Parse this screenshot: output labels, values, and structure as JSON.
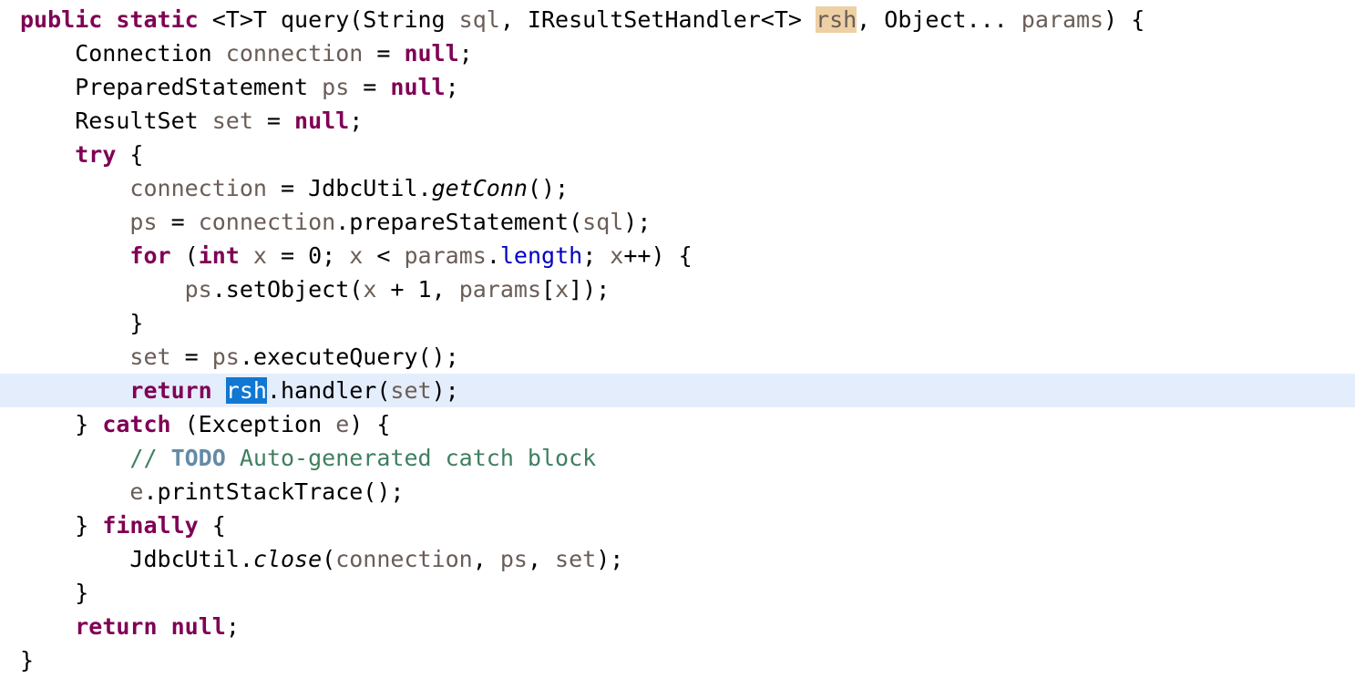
{
  "editor": {
    "language": "java",
    "colors": {
      "background": "#FFFFFF",
      "keyword": "#7F0055",
      "comment": "#3F7F5F",
      "todo": "#638BA6",
      "field": "#0000C0",
      "local_variable": "#6A5D57",
      "occurrence_highlight": "#EDD1A4",
      "selection_background": "#1077D3",
      "selection_foreground": "#FFFFFF",
      "current_line_background": "#E4EDFB",
      "plain_text": "#000000"
    },
    "selection": {
      "text": "rsh",
      "line_index": 10
    },
    "occurrence_highlight": {
      "text": "rsh",
      "line_index": 0
    },
    "current_line_index": 10,
    "lines": [
      {
        "index": 0,
        "current": false,
        "tokens": [
          {
            "t": "public",
            "c": "keyword"
          },
          {
            "t": " ",
            "c": "plain"
          },
          {
            "t": "static",
            "c": "keyword"
          },
          {
            "t": " <T>T query(String ",
            "c": "plain"
          },
          {
            "t": "sql",
            "c": "param"
          },
          {
            "t": ", IResultSetHandler<T> ",
            "c": "plain"
          },
          {
            "t": "rsh",
            "c": "param",
            "hl": "occurrence"
          },
          {
            "t": ", Object... ",
            "c": "plain"
          },
          {
            "t": "params",
            "c": "param"
          },
          {
            "t": ") {",
            "c": "plain"
          }
        ]
      },
      {
        "index": 1,
        "current": false,
        "tokens": [
          {
            "t": "    Connection ",
            "c": "plain"
          },
          {
            "t": "connection",
            "c": "local"
          },
          {
            "t": " = ",
            "c": "plain"
          },
          {
            "t": "null",
            "c": "keyword"
          },
          {
            "t": ";",
            "c": "plain"
          }
        ]
      },
      {
        "index": 2,
        "current": false,
        "tokens": [
          {
            "t": "    PreparedStatement ",
            "c": "plain"
          },
          {
            "t": "ps",
            "c": "local"
          },
          {
            "t": " = ",
            "c": "plain"
          },
          {
            "t": "null",
            "c": "keyword"
          },
          {
            "t": ";",
            "c": "plain"
          }
        ]
      },
      {
        "index": 3,
        "current": false,
        "tokens": [
          {
            "t": "    ResultSet ",
            "c": "plain"
          },
          {
            "t": "set",
            "c": "local"
          },
          {
            "t": " = ",
            "c": "plain"
          },
          {
            "t": "null",
            "c": "keyword"
          },
          {
            "t": ";",
            "c": "plain"
          }
        ]
      },
      {
        "index": 4,
        "current": false,
        "tokens": [
          {
            "t": "    ",
            "c": "plain"
          },
          {
            "t": "try",
            "c": "keyword"
          },
          {
            "t": " {",
            "c": "plain"
          }
        ]
      },
      {
        "index": 5,
        "current": false,
        "tokens": [
          {
            "t": "        ",
            "c": "plain"
          },
          {
            "t": "connection",
            "c": "local"
          },
          {
            "t": " = JdbcUtil.",
            "c": "plain"
          },
          {
            "t": "getConn",
            "c": "static"
          },
          {
            "t": "();",
            "c": "plain"
          }
        ]
      },
      {
        "index": 6,
        "current": false,
        "tokens": [
          {
            "t": "        ",
            "c": "plain"
          },
          {
            "t": "ps",
            "c": "local"
          },
          {
            "t": " = ",
            "c": "plain"
          },
          {
            "t": "connection",
            "c": "local"
          },
          {
            "t": ".prepareStatement(",
            "c": "plain"
          },
          {
            "t": "sql",
            "c": "param"
          },
          {
            "t": ");",
            "c": "plain"
          }
        ]
      },
      {
        "index": 7,
        "current": false,
        "tokens": [
          {
            "t": "        ",
            "c": "plain"
          },
          {
            "t": "for",
            "c": "keyword"
          },
          {
            "t": " (",
            "c": "plain"
          },
          {
            "t": "int",
            "c": "keyword"
          },
          {
            "t": " ",
            "c": "plain"
          },
          {
            "t": "x",
            "c": "local"
          },
          {
            "t": " = 0; ",
            "c": "plain"
          },
          {
            "t": "x",
            "c": "local"
          },
          {
            "t": " < ",
            "c": "plain"
          },
          {
            "t": "params",
            "c": "param"
          },
          {
            "t": ".",
            "c": "plain"
          },
          {
            "t": "length",
            "c": "field"
          },
          {
            "t": "; ",
            "c": "plain"
          },
          {
            "t": "x",
            "c": "local"
          },
          {
            "t": "++) {",
            "c": "plain"
          }
        ]
      },
      {
        "index": 8,
        "current": false,
        "tokens": [
          {
            "t": "            ",
            "c": "plain"
          },
          {
            "t": "ps",
            "c": "local"
          },
          {
            "t": ".setObject(",
            "c": "plain"
          },
          {
            "t": "x",
            "c": "local"
          },
          {
            "t": " + 1, ",
            "c": "plain"
          },
          {
            "t": "params",
            "c": "param"
          },
          {
            "t": "[",
            "c": "plain"
          },
          {
            "t": "x",
            "c": "local"
          },
          {
            "t": "]);",
            "c": "plain"
          }
        ]
      },
      {
        "index": 9,
        "current": false,
        "tokens": [
          {
            "t": "        }",
            "c": "plain"
          }
        ]
      },
      {
        "index": 10,
        "current": false,
        "tokens": [
          {
            "t": "        ",
            "c": "plain"
          },
          {
            "t": "set",
            "c": "local"
          },
          {
            "t": " = ",
            "c": "plain"
          },
          {
            "t": "ps",
            "c": "local"
          },
          {
            "t": ".executeQuery();",
            "c": "plain"
          }
        ]
      },
      {
        "index": 11,
        "current": true,
        "tokens": [
          {
            "t": "        ",
            "c": "plain"
          },
          {
            "t": "return",
            "c": "keyword"
          },
          {
            "t": " ",
            "c": "plain"
          },
          {
            "t": "rsh",
            "c": "param",
            "hl": "selection"
          },
          {
            "t": ".handler(",
            "c": "plain"
          },
          {
            "t": "set",
            "c": "local"
          },
          {
            "t": ");",
            "c": "plain"
          }
        ]
      },
      {
        "index": 12,
        "current": false,
        "tokens": [
          {
            "t": "    } ",
            "c": "plain"
          },
          {
            "t": "catch",
            "c": "keyword"
          },
          {
            "t": " (Exception ",
            "c": "plain"
          },
          {
            "t": "e",
            "c": "local"
          },
          {
            "t": ") {",
            "c": "plain"
          }
        ]
      },
      {
        "index": 13,
        "current": false,
        "tokens": [
          {
            "t": "        ",
            "c": "plain"
          },
          {
            "t": "// ",
            "c": "comment"
          },
          {
            "t": "TODO",
            "c": "todo"
          },
          {
            "t": " Auto-generated catch block",
            "c": "comment"
          }
        ]
      },
      {
        "index": 14,
        "current": false,
        "tokens": [
          {
            "t": "        ",
            "c": "plain"
          },
          {
            "t": "e",
            "c": "local"
          },
          {
            "t": ".printStackTrace();",
            "c": "plain"
          }
        ]
      },
      {
        "index": 15,
        "current": false,
        "tokens": [
          {
            "t": "    } ",
            "c": "plain"
          },
          {
            "t": "finally",
            "c": "keyword"
          },
          {
            "t": " {",
            "c": "plain"
          }
        ]
      },
      {
        "index": 16,
        "current": false,
        "tokens": [
          {
            "t": "        JdbcUtil.",
            "c": "plain"
          },
          {
            "t": "close",
            "c": "static"
          },
          {
            "t": "(",
            "c": "plain"
          },
          {
            "t": "connection",
            "c": "local"
          },
          {
            "t": ", ",
            "c": "plain"
          },
          {
            "t": "ps",
            "c": "local"
          },
          {
            "t": ", ",
            "c": "plain"
          },
          {
            "t": "set",
            "c": "local"
          },
          {
            "t": ");",
            "c": "plain"
          }
        ]
      },
      {
        "index": 17,
        "current": false,
        "tokens": [
          {
            "t": "    }",
            "c": "plain"
          }
        ]
      },
      {
        "index": 18,
        "current": false,
        "tokens": [
          {
            "t": "    ",
            "c": "plain"
          },
          {
            "t": "return",
            "c": "keyword"
          },
          {
            "t": " ",
            "c": "plain"
          },
          {
            "t": "null",
            "c": "keyword"
          },
          {
            "t": ";",
            "c": "plain"
          }
        ]
      },
      {
        "index": 19,
        "current": false,
        "tokens": [
          {
            "t": "}",
            "c": "plain"
          }
        ]
      }
    ]
  }
}
